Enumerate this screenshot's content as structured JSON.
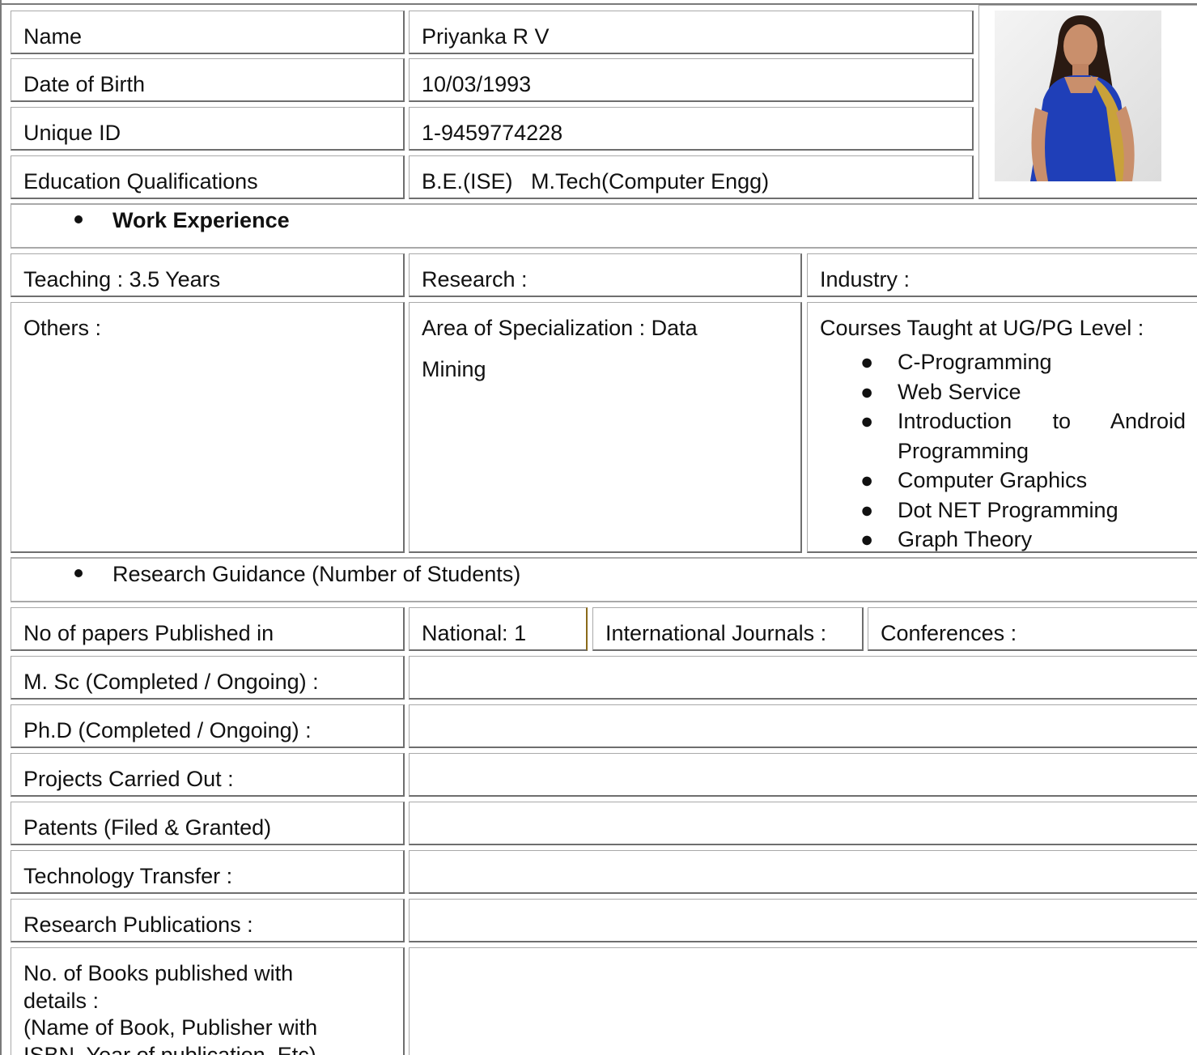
{
  "profile": {
    "name_label": "Name",
    "name_value": "Priyanka R V",
    "dob_label": "Date of Birth",
    "dob_value": "10/03/1993",
    "uid_label": "Unique ID",
    "uid_value": "1-9459774228",
    "edu_label": "Education Qualifications",
    "edu_value": "B.E.(ISE)   M.Tech(Computer Engg)"
  },
  "work": {
    "heading": "Work Experience",
    "teaching": "Teaching : 3.5 Years",
    "research": "Research :",
    "industry": "Industry :",
    "others": "Others :",
    "area_line1": "Area of Specialization : Data",
    "area_line2": "Mining",
    "courses_heading": "Courses Taught at UG/PG Level :",
    "courses": [
      "C-Programming",
      "Web Service",
      "Introduction to Android",
      "Programming",
      "Computer Graphics",
      "Dot NET Programming",
      "Graph Theory"
    ]
  },
  "guidance": {
    "heading": "Research Guidance (Number of Students)",
    "papers_label": "No of papers Published in",
    "national": "National: 1",
    "international": "International Journals :",
    "conferences": "Conferences :",
    "msc": "M. Sc (Completed / Ongoing) :",
    "phd": "Ph.D (Completed / Ongoing) :",
    "projects": "Projects Carried Out :",
    "patents": "Patents (Filed & Granted)",
    "tech_transfer": "Technology Transfer :",
    "publications": "Research Publications :",
    "books_line1": "No. of Books published with",
    "books_line2": "details :",
    "books_line3": "(Name of Book, Publisher with",
    "books_line4": "ISBN, Year of publication, Etc)"
  },
  "colors": {
    "border_dark": "#6e6e6e",
    "border_light": "#a9a9a9",
    "national_divider": "#8a6a1a",
    "photo_saree": "#1f3fb8"
  }
}
